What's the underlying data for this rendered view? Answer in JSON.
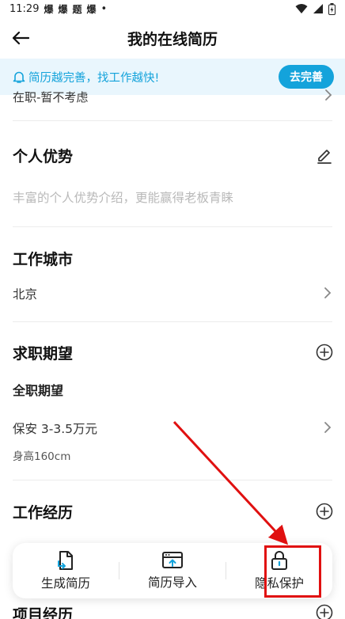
{
  "status_bar": {
    "time": "11:29",
    "notif_icons": [
      "爆",
      "爆",
      "题",
      "爆"
    ]
  },
  "nav": {
    "title": "我的在线简历"
  },
  "tip": {
    "text": "简历越完善，找工作越快!",
    "button": "去完善"
  },
  "partial_top": {
    "text": "在职-暂不考虑"
  },
  "sections": {
    "advantage": {
      "title": "个人优势",
      "placeholder": "丰富的个人优势介绍，更能赢得老板青睐"
    },
    "city": {
      "title": "工作城市",
      "value": "北京"
    },
    "expectation": {
      "title": "求职期望",
      "subtitle": "全职期望",
      "job": "保安  3-3.5万元",
      "detail": "身高160cm"
    },
    "experience": {
      "title": "工作经历"
    },
    "project": {
      "title": "项目经历"
    }
  },
  "bottom_bar": {
    "items": [
      {
        "label": "生成简历",
        "icon": "document-generate-icon"
      },
      {
        "label": "简历导入",
        "icon": "browser-import-icon"
      },
      {
        "label": "隐私保护",
        "icon": "lock-icon"
      }
    ]
  },
  "colors": {
    "accent": "#14a3db",
    "tip_bg": "#e9f6fd",
    "annotation": "#e01010"
  }
}
